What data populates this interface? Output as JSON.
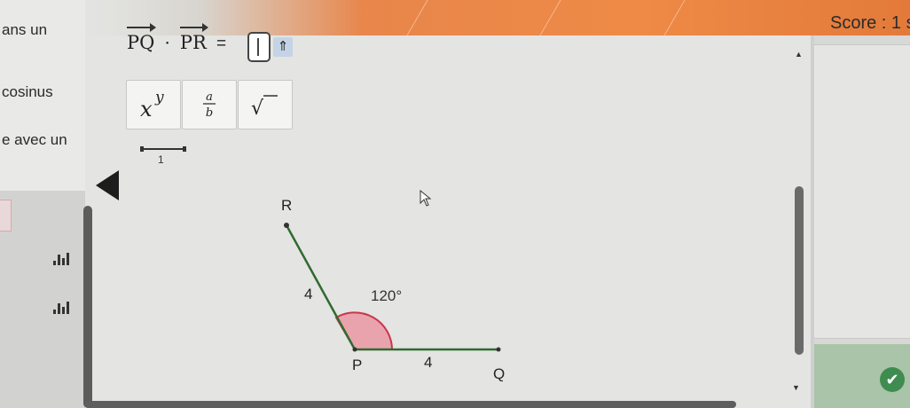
{
  "header": {
    "score_text": "Score : 1 s"
  },
  "left_panel": {
    "lines": [
      "ans un",
      "cosinus",
      "e avec un"
    ],
    "icons": [
      "bar-chart-icon",
      "bar-chart-icon"
    ]
  },
  "equation": {
    "vec1": "PQ",
    "operator": "·",
    "vec2": "PR",
    "equals": "=",
    "answer_value": "",
    "shift_symbol": "⇑"
  },
  "keyboard": {
    "power_base": "x",
    "power_exp": "y",
    "frac_num": "a",
    "frac_den": "b",
    "sqrt_symbol": "√"
  },
  "scale": {
    "label": "1"
  },
  "figure": {
    "point_R": "R",
    "point_P": "P",
    "point_Q": "Q",
    "length_PR": "4",
    "length_PQ": "4",
    "angle": "120°"
  },
  "colors": {
    "segment": "#2f6b2f",
    "angle_fill": "#e9a3ad",
    "angle_stroke": "#c8374a",
    "banner": "#ee8a46",
    "check": "#3e8c50"
  }
}
